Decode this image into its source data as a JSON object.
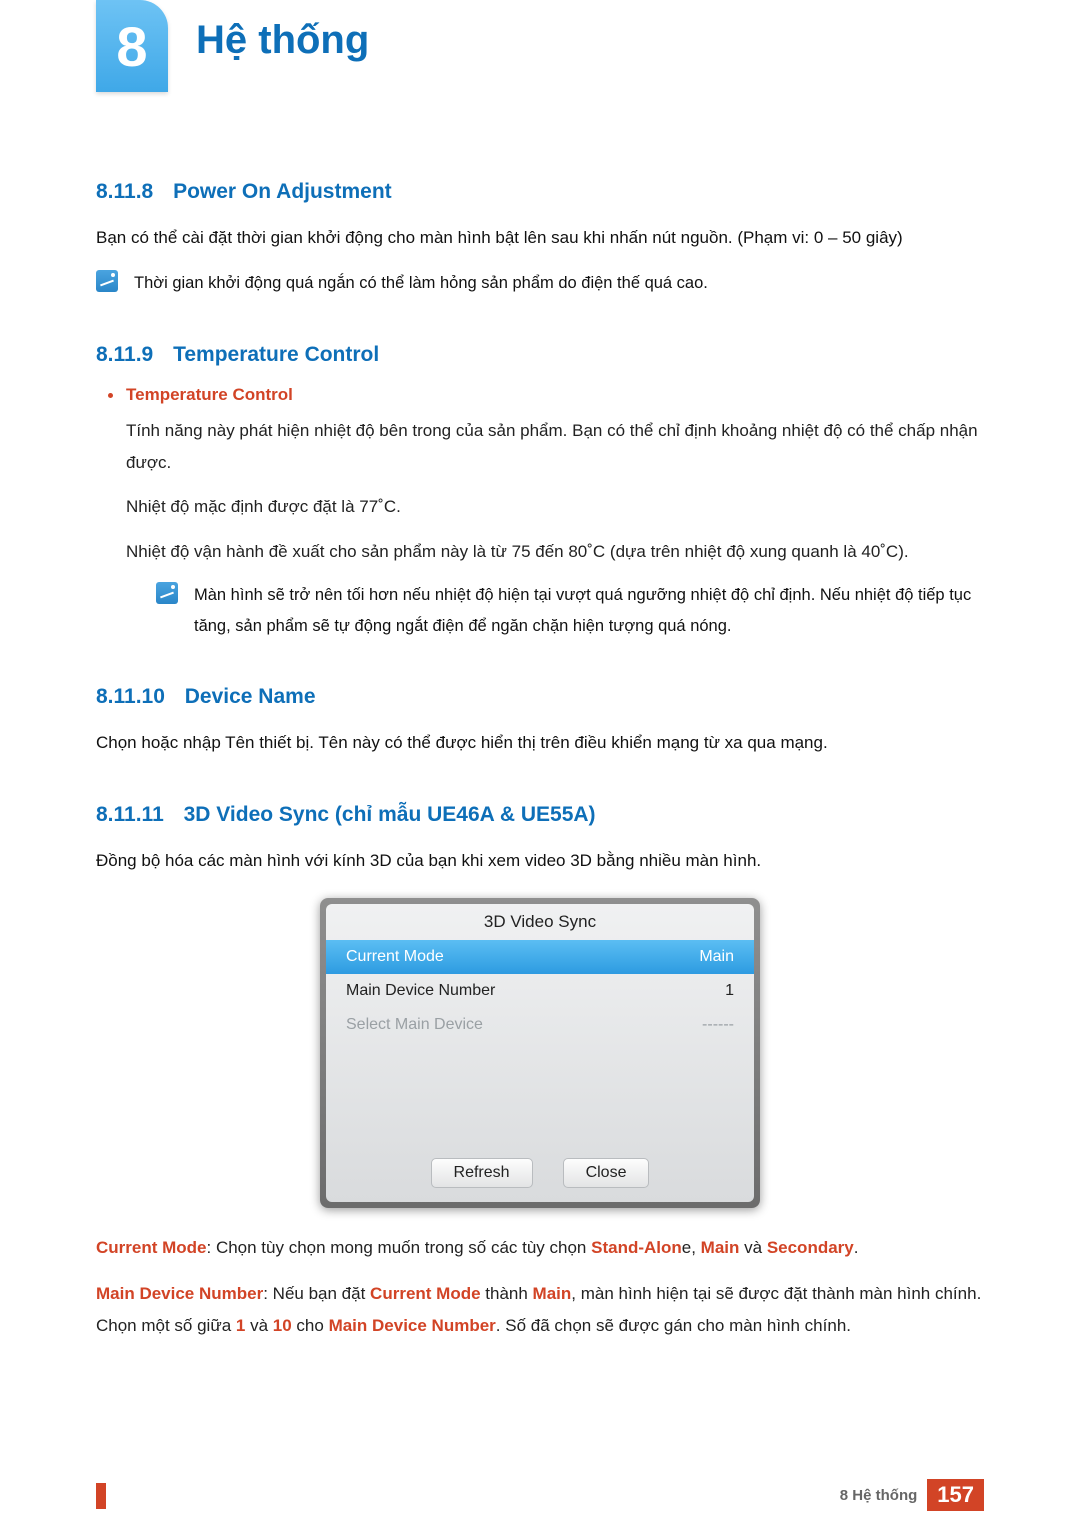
{
  "chapter": {
    "number": "8",
    "title": "Hệ thống"
  },
  "s1": {
    "num": "8.11.8",
    "title": "Power On Adjustment",
    "p1": "Bạn có thể cài đặt thời gian khởi động cho màn hình bật lên sau khi nhấn nút nguồn. (Phạm vi: 0 – 50 giây)",
    "note": "Thời gian khởi động quá ngắn có thể làm hỏng sản phẩm do điện thế quá cao."
  },
  "s2": {
    "num": "8.11.9",
    "title": "Temperature Control",
    "bullet_title": "Temperature Control",
    "bp1": "Tính năng này phát hiện nhiệt độ bên trong của sản phẩm. Bạn có thể chỉ định khoảng nhiệt độ có thể chấp nhận được.",
    "bp2": "Nhiệt độ mặc định được đặt là 77˚C.",
    "bp3": "Nhiệt độ vận hành đề xuất cho sản phẩm này là từ 75 đến 80˚C (dựa trên nhiệt độ xung quanh là 40˚C).",
    "note": "Màn hình sẽ trở nên tối hơn nếu nhiệt độ hiện tại vượt quá ngưỡng nhiệt độ chỉ định. Nếu nhiệt độ tiếp tục tăng, sản phẩm sẽ tự động ngắt điện để ngăn chặn hiện tượng quá nóng."
  },
  "s3": {
    "num": "8.11.10",
    "title": "Device Name",
    "p1": "Chọn hoặc nhập Tên thiết bị. Tên này có thể được hiển thị trên điều khiển mạng từ xa qua mạng."
  },
  "s4": {
    "num": "8.11.11",
    "title": "3D Video Sync (chỉ mẫu UE46A & UE55A)",
    "p1": "Đồng bộ hóa các màn hình với kính 3D của bạn khi xem video 3D bằng nhiều màn hình."
  },
  "dialog": {
    "title": "3D Video Sync",
    "r1_label": "Current Mode",
    "r1_value": "Main",
    "r2_label": "Main Device Number",
    "r2_value": "1",
    "r3_label": "Select Main Device",
    "r3_value": "------",
    "btn_refresh": "Refresh",
    "btn_close": "Close"
  },
  "desc": {
    "cm_label": "Current Mode",
    "cm_text1": ": Chọn tùy chọn mong muốn trong số các tùy chọn ",
    "cm_opt1": "Stand-Alon",
    "cm_text2": "e, ",
    "cm_opt2": "Main",
    "cm_text3": " và ",
    "cm_opt3": "Secondary",
    "cm_text4": ".",
    "mdn_label": "Main Device Number",
    "mdn_text1": ": Nếu bạn đặt ",
    "mdn_cm": "Current Mode",
    "mdn_text2": " thành ",
    "mdn_main": "Main",
    "mdn_text3": ", màn hình hiện tại sẽ được đặt thành màn hình chính. Chọn một số giữa ",
    "mdn_1": "1",
    "mdn_text4": " và ",
    "mdn_10": "10",
    "mdn_text5": " cho ",
    "mdn_lbl2": "Main Device Number",
    "mdn_text6": ". Số đã chọn sẽ được gán cho màn hình chính."
  },
  "footer": {
    "section": "8 Hệ thống",
    "page": "157"
  }
}
